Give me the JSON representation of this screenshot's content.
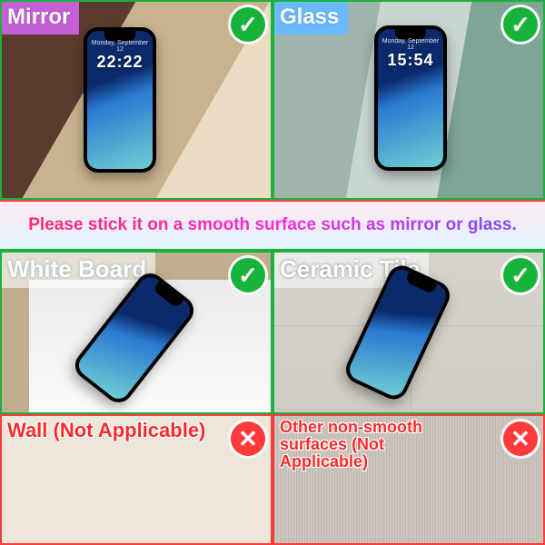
{
  "panels": {
    "mirror": {
      "label": "Mirror",
      "status": "ok",
      "clock": "22:22"
    },
    "glass": {
      "label": "Glass",
      "status": "ok",
      "clock": "15:54"
    },
    "board": {
      "label": "White Board",
      "status": "ok"
    },
    "tile": {
      "label": "Ceramic Tile",
      "status": "ok"
    },
    "wall": {
      "label": "Wall ",
      "na": "(Not Applicable)",
      "status": "no"
    },
    "other": {
      "label": "Other non-smooth surfaces  ",
      "na": "(Not Applicable)",
      "status": "no"
    }
  },
  "banner": "Please stick it on a smooth surface such as mirror or glass.",
  "glyph": {
    "ok": "✓",
    "no": "✕"
  },
  "phone_date": "Monday, September 12"
}
